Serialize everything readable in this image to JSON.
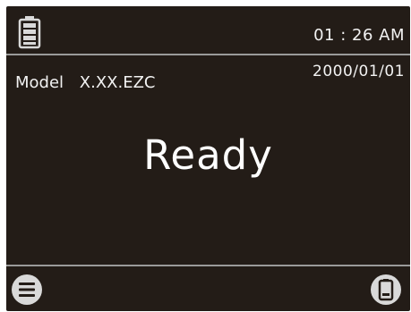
{
  "status_bar": {
    "battery_icon": "battery-full-icon",
    "time": "01 : 26 AM"
  },
  "info": {
    "date": "2000/01/01",
    "model_label": "Model",
    "model_value": "X.XX.EZC"
  },
  "main": {
    "status": "Ready"
  },
  "footer": {
    "left_icon": "menu-icon",
    "right_icon": "device-icon"
  },
  "colors": {
    "background": "#231c17",
    "text": "#f2f2f2",
    "divider": "#9a9a9a",
    "icon_fill": "#d9d9d9"
  }
}
